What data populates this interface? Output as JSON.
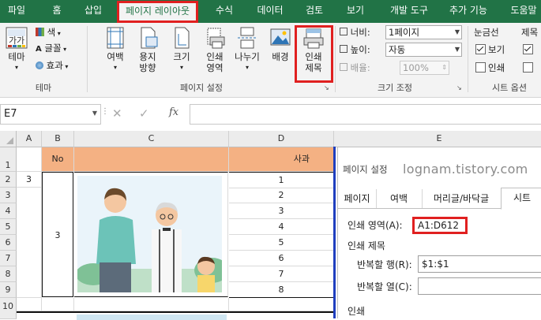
{
  "tabs": [
    "파일",
    "홈",
    "삽입",
    "페이지 레이아웃",
    "수식",
    "데이터",
    "검토",
    "보기",
    "개발 도구",
    "추가 기능",
    "도움말"
  ],
  "ribbon": {
    "theme_group": {
      "label": "테마",
      "theme_button": "테마",
      "colors": "색",
      "fonts": "글꼴",
      "effects": "효과"
    },
    "page_setup_group": {
      "label": "페이지 설정",
      "margins": "여백",
      "orientation_line1": "용지",
      "orientation_line2": "방향",
      "size": "크기",
      "print_area_line1": "인쇄",
      "print_area_line2": "영역",
      "breaks": "나누기",
      "background": "배경",
      "print_titles_line1": "인쇄",
      "print_titles_line2": "제목"
    },
    "scale_group": {
      "label": "크기 조정",
      "width_label": "너비:",
      "width_value": "1페이지",
      "height_label": "높이:",
      "height_value": "자동",
      "scale_label": "배율:",
      "scale_value": "100%"
    },
    "sheet_options_group": {
      "label": "시트 옵션",
      "gridlines": "눈금선",
      "headings": "제목",
      "view": "보기",
      "print": "인쇄"
    }
  },
  "formula_bar": {
    "name_box": "E7",
    "fx": "fx",
    "value": ""
  },
  "sheet": {
    "columns": [
      "A",
      "B",
      "C",
      "D",
      "E"
    ],
    "rows": [
      "1",
      "2",
      "3",
      "4",
      "5",
      "6",
      "7",
      "8",
      "9",
      "10"
    ],
    "header_no": "No",
    "header_apple": "사과",
    "a2": "3",
    "b_merged": "3",
    "d_values": [
      "1",
      "2",
      "3",
      "4",
      "5",
      "6",
      "7",
      "8"
    ]
  },
  "dialog": {
    "title": "페이지 설정",
    "watermark": "lognam.tistory.com",
    "tabs": [
      "페이지",
      "여백",
      "머리글/바닥글",
      "시트"
    ],
    "print_area_label": "인쇄 영역(A):",
    "print_area_value": "A1:D612",
    "print_titles_section": "인쇄 제목",
    "repeat_rows_label": "반복할 행(R):",
    "repeat_rows_value": "$1:$1",
    "repeat_cols_label": "반복할 열(C):",
    "repeat_cols_value": "",
    "print_section": "인쇄"
  },
  "colors": {
    "excel_green": "#217346",
    "highlight_red": "#e02020",
    "header_orange": "#f4b183",
    "selection_blue": "#1f3fbf"
  }
}
